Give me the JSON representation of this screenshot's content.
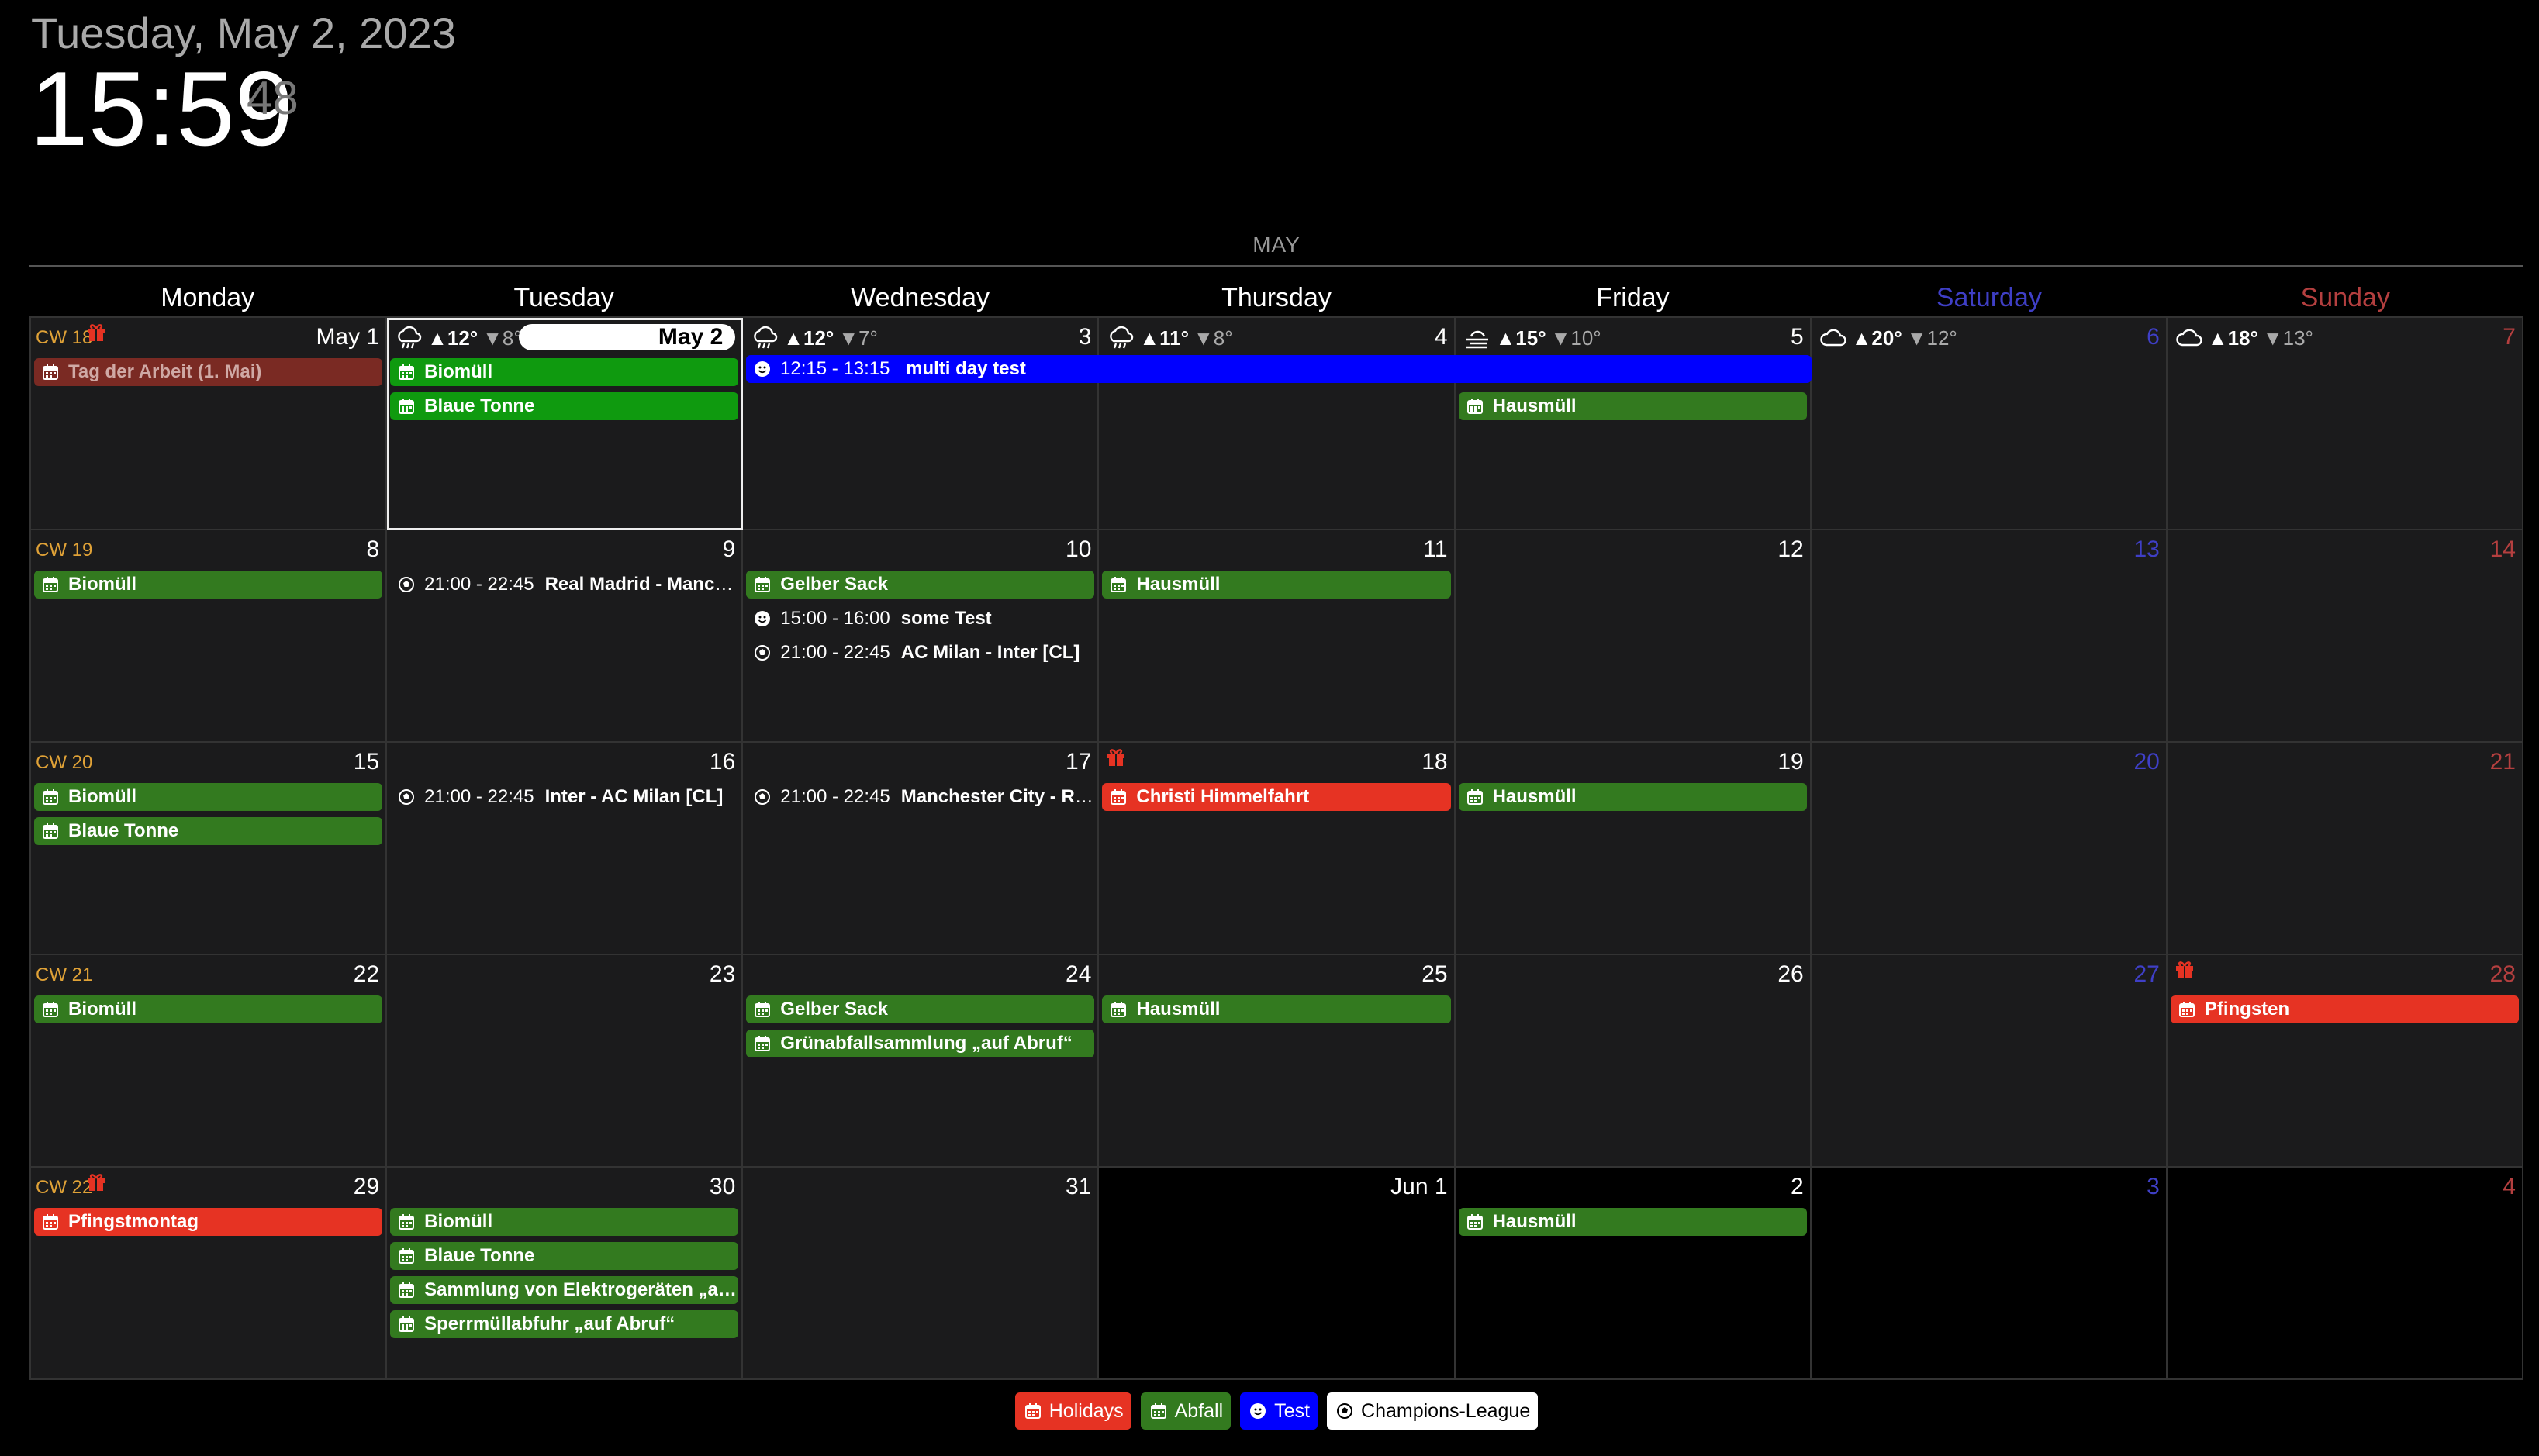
{
  "clock": {
    "date": "Tuesday, May 2, 2023",
    "time": "15:59",
    "seconds": "48"
  },
  "month_label": "MAY",
  "weekdays": [
    "Monday",
    "Tuesday",
    "Wednesday",
    "Thursday",
    "Friday",
    "Saturday",
    "Sunday"
  ],
  "colors": {
    "abfall": "#337a1f",
    "holidays": "#e63323",
    "test": "#0000ff",
    "champions": "#ffffff",
    "week_number": "#e0a237"
  },
  "weeks": [
    {
      "cw": "CW 18",
      "days": [
        "May 1",
        "May 2",
        "3",
        "4",
        "5",
        "6",
        "7"
      ]
    },
    {
      "cw": "CW 19",
      "days": [
        "8",
        "9",
        "10",
        "11",
        "12",
        "13",
        "14"
      ]
    },
    {
      "cw": "CW 20",
      "days": [
        "15",
        "16",
        "17",
        "18",
        "19",
        "20",
        "21"
      ]
    },
    {
      "cw": "CW 21",
      "days": [
        "22",
        "23",
        "24",
        "25",
        "26",
        "27",
        "28"
      ]
    },
    {
      "cw": "CW 22",
      "days": [
        "29",
        "30",
        "31",
        "Jun 1",
        "2",
        "3",
        "4"
      ]
    }
  ],
  "weather": [
    {
      "icon": "rain-icon",
      "hi": "▲12°",
      "lo": "▼8°"
    },
    {
      "icon": "rain-icon",
      "hi": "▲12°",
      "lo": "▼7°"
    },
    {
      "icon": "rain-icon",
      "hi": "▲11°",
      "lo": "▼8°"
    },
    {
      "icon": "haze-icon",
      "hi": "▲15°",
      "lo": "▼10°"
    },
    {
      "icon": "cloud-icon",
      "hi": "▲20°",
      "lo": "▼12°"
    },
    {
      "icon": "cloud-icon",
      "hi": "▲18°",
      "lo": "▼13°"
    }
  ],
  "events": {
    "w1_mon_1": "Tag der Arbeit (1. Mai)",
    "w1_tue_1": "Biomüll",
    "w1_tue_2": "Blaue Tonne",
    "w1_multi_time": "12:15 - 13:15",
    "w1_multi_title": "multi day test",
    "w1_fri_1": "Hausmüll",
    "w2_mon_1": "Biomüll",
    "w2_tue_time": "21:00 - 22:45",
    "w2_tue_title": "Real Madrid - Manchester City [CL]",
    "w2_wed_1": "Gelber Sack",
    "w2_wed_2_time": "15:00 - 16:00",
    "w2_wed_2_title": "some Test",
    "w2_wed_3_time": "21:00 - 22:45",
    "w2_wed_3_title": "AC Milan - Inter [CL]",
    "w2_thu_1": "Hausmüll",
    "w3_mon_1": "Biomüll",
    "w3_mon_2": "Blaue Tonne",
    "w3_tue_time": "21:00 - 22:45",
    "w3_tue_title": "Inter - AC Milan [CL]",
    "w3_wed_time": "21:00 - 22:45",
    "w3_wed_title": "Manchester City - Real Madrid [CL]",
    "w3_thu_1": "Christi Himmelfahrt",
    "w3_fri_1": "Hausmüll",
    "w4_mon_1": "Biomüll",
    "w4_wed_1": "Gelber Sack",
    "w4_wed_2": "Grünabfallsammlung „auf Abruf“",
    "w4_thu_1": "Hausmüll",
    "w4_sun_1": "Pfingsten",
    "w5_mon_1": "Pfingstmontag",
    "w5_tue_1": "Biomüll",
    "w5_tue_2": "Blaue Tonne",
    "w5_tue_3": "Sammlung von Elektrogeräten „auf Abruf“",
    "w5_tue_4": "Sperrmüllabfuhr „auf Abruf“",
    "w5_fri_1": "Hausmüll"
  },
  "legend": [
    "Holidays",
    "Abfall",
    "Test",
    "Champions-League"
  ]
}
